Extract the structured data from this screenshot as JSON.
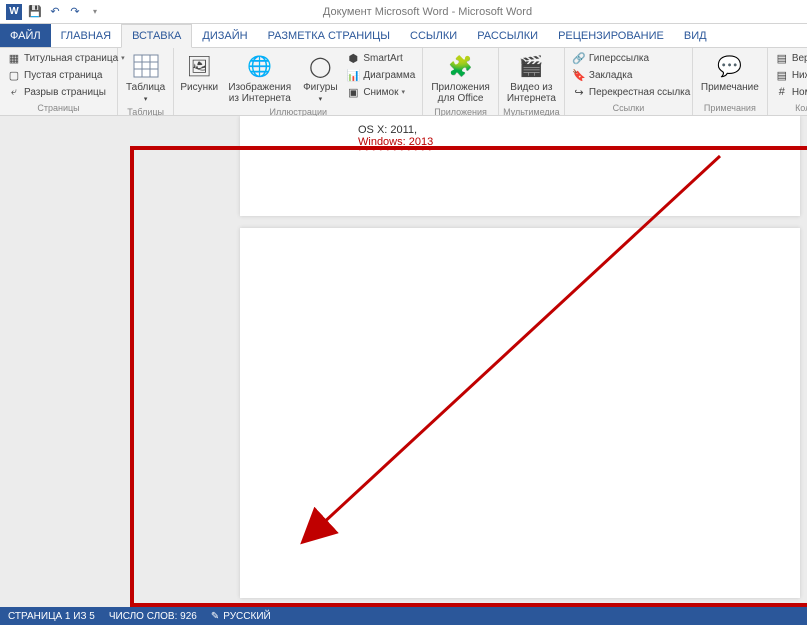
{
  "app": {
    "title": "Документ Microsoft Word - Microsoft Word"
  },
  "qat": {
    "save": "💾",
    "undo": "↶",
    "redo": "↷",
    "customize": "▾"
  },
  "tabs": {
    "file": "ФАЙЛ",
    "home": "ГЛАВНАЯ",
    "insert": "ВСТАВКА",
    "design": "ДИЗАЙН",
    "layout": "РАЗМЕТКА СТРАНИЦЫ",
    "references": "ССЫЛКИ",
    "mailings": "РАССЫЛКИ",
    "review": "РЕЦЕНЗИРОВАНИЕ",
    "view": "ВИД"
  },
  "ribbon": {
    "pages": {
      "cover": "Титульная страница",
      "blank": "Пустая страница",
      "break": "Разрыв страницы",
      "label": "Страницы"
    },
    "tables": {
      "table": "Таблица",
      "label": "Таблицы"
    },
    "illustrations": {
      "pictures": "Рисунки",
      "online": "Изображения из Интернета",
      "shapes": "Фигуры",
      "smartart": "SmartArt",
      "chart": "Диаграмма",
      "screenshot": "Снимок",
      "label": "Иллюстрации"
    },
    "apps": {
      "office": "Приложения для Office",
      "label": "Приложения"
    },
    "media": {
      "video": "Видео из Интернета",
      "label": "Мультимедиа"
    },
    "links": {
      "hyperlink": "Гиперссылка",
      "bookmark": "Закладка",
      "crossref": "Перекрестная ссылка",
      "label": "Ссылки"
    },
    "comments": {
      "comment": "Примечание",
      "label": "Примечания"
    },
    "headerfooter": {
      "header": "Верхний колонт",
      "footer": "Нижний колонт",
      "pagenum": "Номер страницы",
      "label": "Колонтитулы"
    }
  },
  "document": {
    "line1": "OS X: 2011,",
    "line2": "Windows: 2013"
  },
  "status": {
    "page": "СТРАНИЦА 1 ИЗ 5",
    "words": "ЧИСЛО СЛОВ: 926",
    "lang": "РУССКИЙ"
  }
}
